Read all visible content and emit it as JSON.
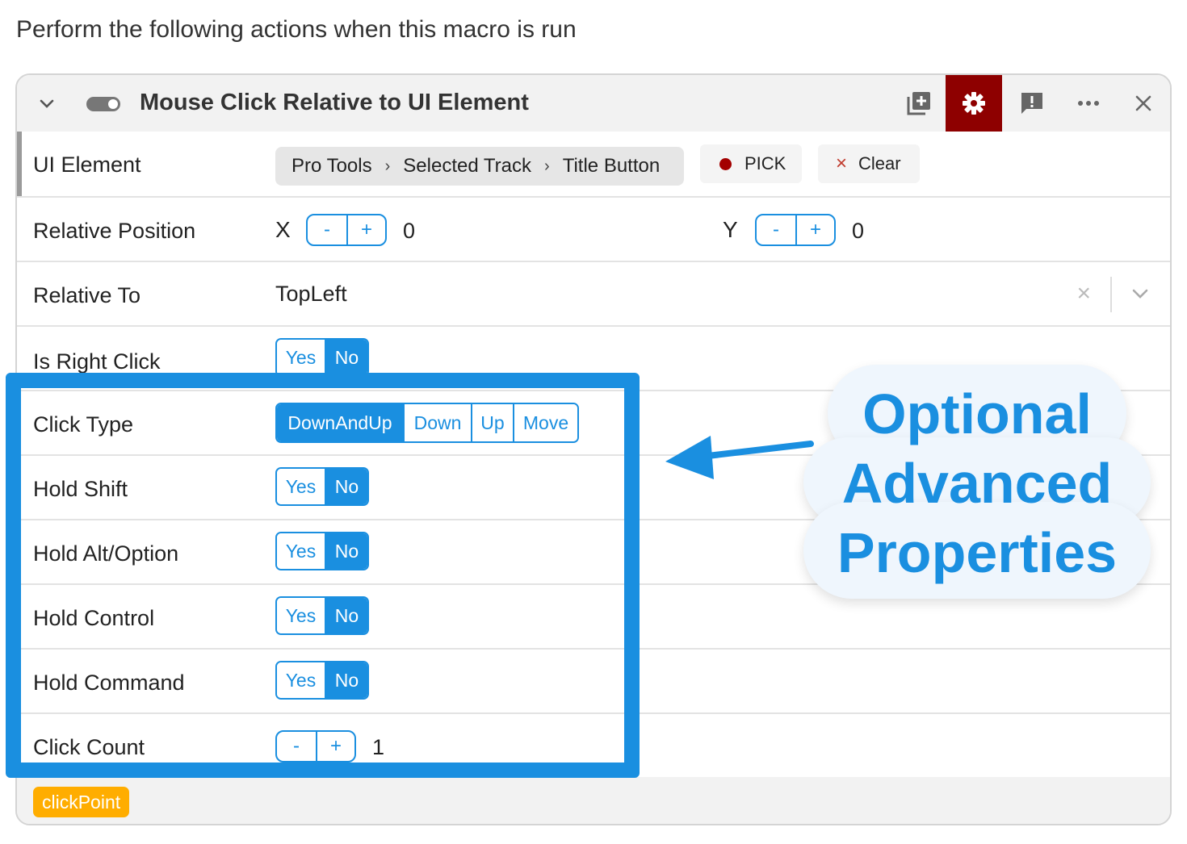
{
  "intro": "Perform the following actions when this macro is run",
  "action": {
    "title": "Mouse Click Relative to UI Element",
    "icons": [
      "chevron-down-icon",
      "toggle-switch",
      "add-box-icon",
      "gear-icon",
      "feedback-icon",
      "more-icon",
      "close-icon"
    ],
    "accent_color": "#8e0000"
  },
  "ui_element": {
    "label": "UI Element",
    "path": [
      "Pro Tools",
      "Selected Track",
      "Title Button"
    ],
    "separator": "›",
    "pick_label": "PICK",
    "clear_label": "Clear"
  },
  "relative_position": {
    "label": "Relative Position",
    "x_label": "X",
    "x_value": "0",
    "y_label": "Y",
    "y_value": "0",
    "minus": "-",
    "plus": "+"
  },
  "relative_to": {
    "label": "Relative To",
    "value": "TopLeft"
  },
  "is_right_click": {
    "label": "Is Right Click",
    "yes": "Yes",
    "no": "No",
    "selected": "No"
  },
  "click_type": {
    "label": "Click Type",
    "options": [
      "DownAndUp",
      "Down",
      "Up",
      "Move"
    ],
    "selected": "DownAndUp"
  },
  "hold_shift": {
    "label": "Hold Shift",
    "yes": "Yes",
    "no": "No",
    "selected": "No"
  },
  "hold_alt": {
    "label": "Hold Alt/Option",
    "yes": "Yes",
    "no": "No",
    "selected": "No"
  },
  "hold_control": {
    "label": "Hold Control",
    "yes": "Yes",
    "no": "No",
    "selected": "No"
  },
  "hold_command": {
    "label": "Hold Command",
    "yes": "Yes",
    "no": "No",
    "selected": "No"
  },
  "click_count": {
    "label": "Click Count",
    "value": "1",
    "minus": "-",
    "plus": "+"
  },
  "output_variable": "clickPoint",
  "callout": {
    "line1": "Optional",
    "line2": "Advanced",
    "line3": "Properties"
  },
  "colors": {
    "primary": "#1a8fe0",
    "badge": "#ffad00",
    "pick_dot": "#a30000"
  }
}
